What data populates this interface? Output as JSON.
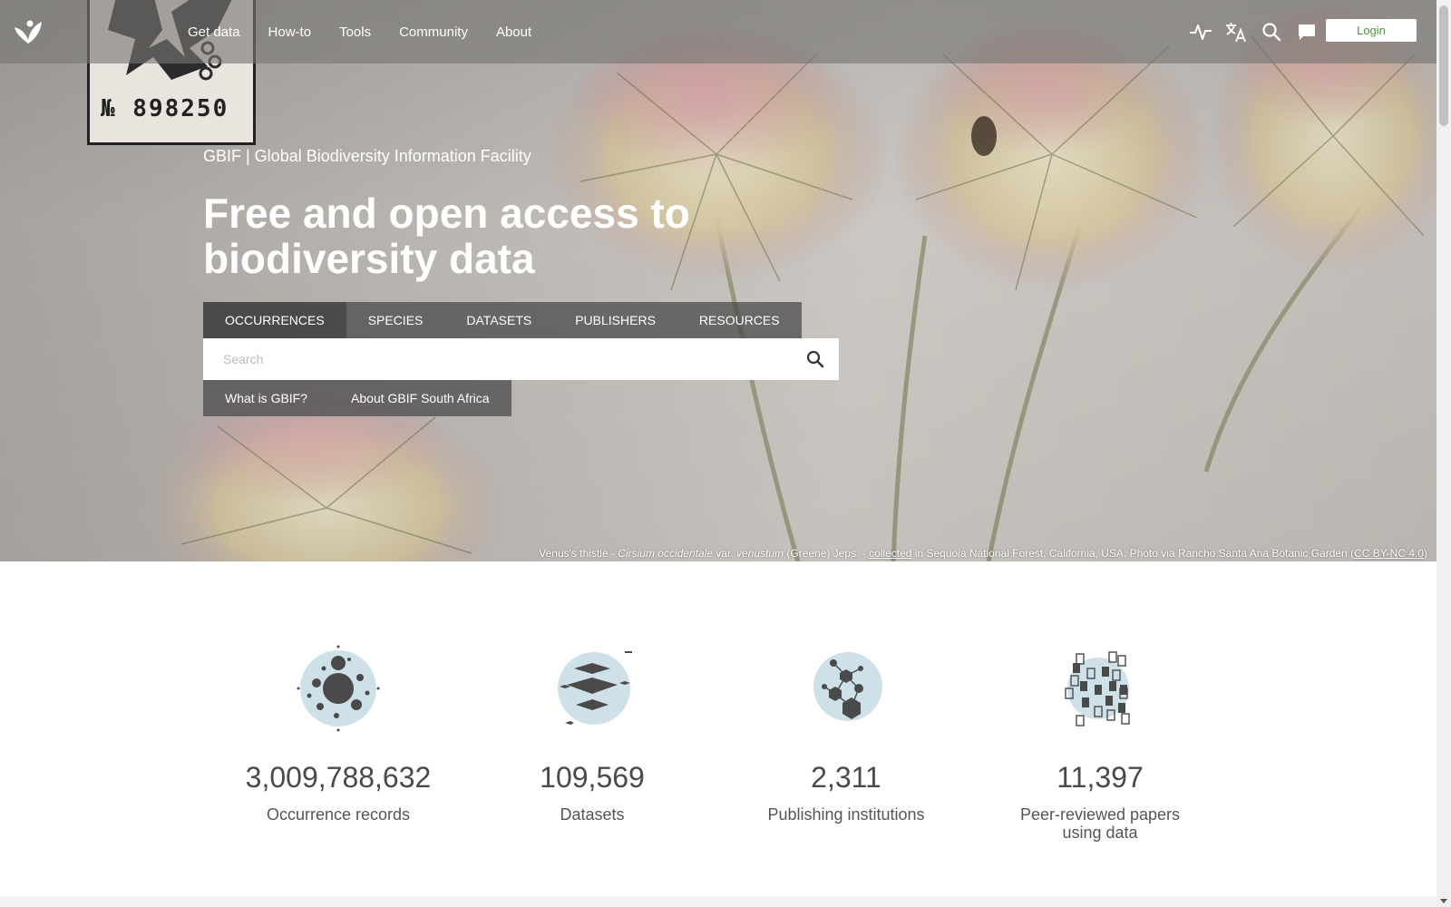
{
  "nav": {
    "items": [
      "Get data",
      "How-to",
      "Tools",
      "Community",
      "About"
    ],
    "icons": [
      "activity-icon",
      "translate-icon",
      "search-icon",
      "feedback-icon"
    ],
    "login_label": "Login"
  },
  "hero": {
    "specimen_number": "№ 898250",
    "subtitle": "GBIF | Global Biodiversity Information Facility",
    "headline": "Free and open access to biodiversity data",
    "tabs": [
      "OCCURRENCES",
      "SPECIES",
      "DATASETS",
      "PUBLISHERS",
      "RESOURCES"
    ],
    "search_placeholder": "Search",
    "links": [
      "What is GBIF?",
      "About GBIF South Africa"
    ],
    "caption": {
      "common_name": "Venus's thistle - ",
      "genus_species": "Cirsium occidentale",
      "var_text": " var. ",
      "variety": "venustum",
      "authority": " (Greene) Jeps. - ",
      "collected_link": "collected",
      "location": " in Sequoia National Forest, California, USA. Photo via Rancho Santa Ana Botanic Garden (",
      "license_link": "CC BY-NC 4.0",
      "close": ")"
    }
  },
  "stats": [
    {
      "number": "3,009,788,632",
      "label": "Occurrence records",
      "icon": "occurrences-icon"
    },
    {
      "number": "109,569",
      "label": "Datasets",
      "icon": "datasets-icon"
    },
    {
      "number": "2,311",
      "label": "Publishing institutions",
      "icon": "publishers-icon"
    },
    {
      "number": "11,397",
      "label": "Peer-reviewed papers using data",
      "icon": "papers-icon"
    }
  ],
  "colors": {
    "accent": "#4e9a39",
    "icon_fill": "#4a4a4a",
    "icon_bg": "#cfe1e8"
  }
}
